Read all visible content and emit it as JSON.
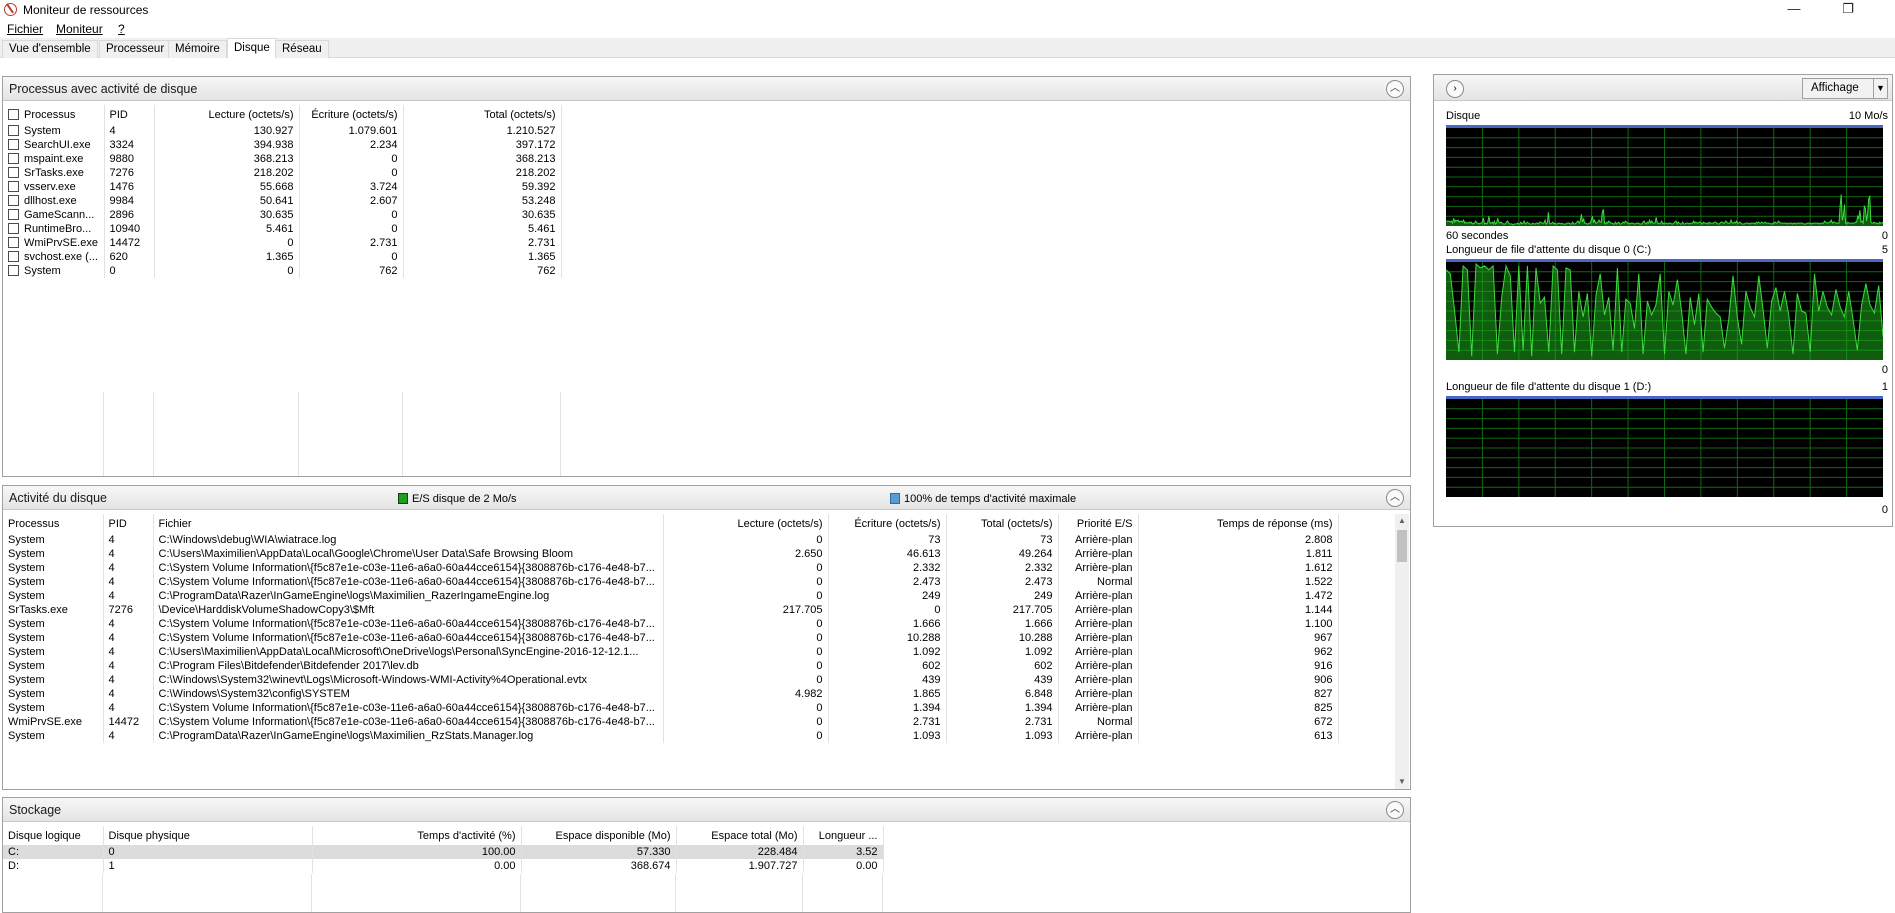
{
  "window": {
    "title": "Moniteur de ressources",
    "minimize": "—",
    "restore": "❐"
  },
  "menu": [
    {
      "label": "Fichier"
    },
    {
      "label": "Moniteur"
    },
    {
      "label": "?"
    }
  ],
  "tabs": [
    "Vue d'ensemble",
    "Processeur",
    "Mémoire",
    "Disque",
    "Réseau"
  ],
  "active_tab": "Disque",
  "processes_panel": {
    "title": "Processus avec activité de disque",
    "columns": [
      "Processus",
      "PID",
      "Lecture (octets/s)",
      "Écriture (octets/s)",
      "Total (octets/s)"
    ],
    "rows": [
      [
        "System",
        "4",
        "130.927",
        "1.079.601",
        "1.210.527"
      ],
      [
        "SearchUI.exe",
        "3324",
        "394.938",
        "2.234",
        "397.172"
      ],
      [
        "mspaint.exe",
        "9880",
        "368.213",
        "0",
        "368.213"
      ],
      [
        "SrTasks.exe",
        "7276",
        "218.202",
        "0",
        "218.202"
      ],
      [
        "vsserv.exe",
        "1476",
        "55.668",
        "3.724",
        "59.392"
      ],
      [
        "dllhost.exe",
        "9984",
        "50.641",
        "2.607",
        "53.248"
      ],
      [
        "GameScann...",
        "2896",
        "30.635",
        "0",
        "30.635"
      ],
      [
        "RuntimeBro...",
        "10940",
        "5.461",
        "0",
        "5.461"
      ],
      [
        "WmiPrvSE.exe",
        "14472",
        "0",
        "2.731",
        "2.731"
      ],
      [
        "svchost.exe (...",
        "620",
        "1.365",
        "0",
        "1.365"
      ],
      [
        "System",
        "0",
        "0",
        "762",
        "762"
      ]
    ]
  },
  "activity_panel": {
    "title": "Activité du disque",
    "legend_io": "E/S disque de 2 Mo/s",
    "legend_active": "100% de temps d'activité maximale",
    "legend_io_color": "#1e9e1e",
    "legend_active_color": "#5b9bd5",
    "columns": [
      "Processus",
      "PID",
      "Fichier",
      "Lecture (octets/s)",
      "Écriture (octets/s)",
      "Total (octets/s)",
      "Priorité E/S",
      "Temps de réponse (ms)"
    ],
    "rows": [
      [
        "System",
        "4",
        "C:\\Windows\\debug\\WIA\\wiatrace.log",
        "0",
        "73",
        "73",
        "Arrière-plan",
        "2.808"
      ],
      [
        "System",
        "4",
        "C:\\Users\\Maximilien\\AppData\\Local\\Google\\Chrome\\User Data\\Safe Browsing Bloom",
        "2.650",
        "46.613",
        "49.264",
        "Arrière-plan",
        "1.811"
      ],
      [
        "System",
        "4",
        "C:\\System Volume Information\\{f5c87e1e-c03e-11e6-a6a0-60a44cce6154}{3808876b-c176-4e48-b7...",
        "0",
        "2.332",
        "2.332",
        "Arrière-plan",
        "1.612"
      ],
      [
        "System",
        "4",
        "C:\\System Volume Information\\{f5c87e1e-c03e-11e6-a6a0-60a44cce6154}{3808876b-c176-4e48-b7...",
        "0",
        "2.473",
        "2.473",
        "Normal",
        "1.522"
      ],
      [
        "System",
        "4",
        "C:\\ProgramData\\Razer\\InGameEngine\\logs\\Maximilien_RazerIngameEngine.log",
        "0",
        "249",
        "249",
        "Arrière-plan",
        "1.472"
      ],
      [
        "SrTasks.exe",
        "7276",
        "\\Device\\HarddiskVolumeShadowCopy3\\$Mft",
        "217.705",
        "0",
        "217.705",
        "Arrière-plan",
        "1.144"
      ],
      [
        "System",
        "4",
        "C:\\System Volume Information\\{f5c87e1e-c03e-11e6-a6a0-60a44cce6154}{3808876b-c176-4e48-b7...",
        "0",
        "1.666",
        "1.666",
        "Arrière-plan",
        "1.100"
      ],
      [
        "System",
        "4",
        "C:\\System Volume Information\\{f5c87e1e-c03e-11e6-a6a0-60a44cce6154}{3808876b-c176-4e48-b7...",
        "0",
        "10.288",
        "10.288",
        "Arrière-plan",
        "967"
      ],
      [
        "System",
        "4",
        "C:\\Users\\Maximilien\\AppData\\Local\\Microsoft\\OneDrive\\logs\\Personal\\SyncEngine-2016-12-12.1...",
        "0",
        "1.092",
        "1.092",
        "Arrière-plan",
        "962"
      ],
      [
        "System",
        "4",
        "C:\\Program Files\\Bitdefender\\Bitdefender 2017\\lev.db",
        "0",
        "602",
        "602",
        "Arrière-plan",
        "916"
      ],
      [
        "System",
        "4",
        "C:\\Windows\\System32\\winevt\\Logs\\Microsoft-Windows-WMI-Activity%4Operational.evtx",
        "0",
        "439",
        "439",
        "Arrière-plan",
        "906"
      ],
      [
        "System",
        "4",
        "C:\\Windows\\System32\\config\\SYSTEM",
        "4.982",
        "1.865",
        "6.848",
        "Arrière-plan",
        "827"
      ],
      [
        "System",
        "4",
        "C:\\System Volume Information\\{f5c87e1e-c03e-11e6-a6a0-60a44cce6154}{3808876b-c176-4e48-b7...",
        "0",
        "1.394",
        "1.394",
        "Arrière-plan",
        "825"
      ],
      [
        "WmiPrvSE.exe",
        "14472",
        "C:\\System Volume Information\\{f5c87e1e-c03e-11e6-a6a0-60a44cce6154}{3808876b-c176-4e48-b7...",
        "0",
        "2.731",
        "2.731",
        "Normal",
        "672"
      ],
      [
        "System",
        "4",
        "C:\\ProgramData\\Razer\\InGameEngine\\logs\\Maximilien_RzStats.Manager.log",
        "0",
        "1.093",
        "1.093",
        "Arrière-plan",
        "613"
      ]
    ]
  },
  "storage_panel": {
    "title": "Stockage",
    "columns": [
      "Disque logique",
      "Disque physique",
      "Temps d'activité (%)",
      "Espace disponible (Mo)",
      "Espace total (Mo)",
      "Longueur ..."
    ],
    "rows": [
      [
        "C:",
        "0",
        "100.00",
        "57.330",
        "228.484",
        "3.52"
      ],
      [
        "D:",
        "1",
        "0.00",
        "368.674",
        "1.907.727",
        "0.00"
      ]
    ]
  },
  "graphs_pane": {
    "views_label": "Affichage",
    "graphs": [
      {
        "title": "Disque",
        "max_label": "10 Mo/s",
        "bottom_left": "60 secondes",
        "min_label": "0",
        "values": [
          5,
          5,
          5,
          5,
          4,
          5,
          3,
          8,
          4,
          6,
          5,
          6,
          4,
          5,
          5,
          4,
          6,
          3,
          4,
          3,
          3,
          4,
          3,
          4,
          2,
          3,
          3,
          5,
          3,
          3,
          2,
          3,
          3,
          4,
          8,
          2,
          3,
          2,
          4,
          10,
          3,
          3,
          4,
          2,
          5,
          2,
          3,
          8,
          4,
          3,
          4,
          3,
          2,
          2,
          2,
          4,
          5,
          3,
          2,
          2,
          2,
          1,
          2,
          2,
          2,
          3,
          2,
          2,
          4,
          2,
          3,
          5,
          2,
          3,
          4,
          3,
          2,
          2,
          2,
          3,
          2,
          2,
          3,
          3,
          2,
          4,
          4,
          3,
          3,
          3,
          6,
          2,
          3,
          14,
          3,
          2,
          3,
          4,
          2,
          3,
          2,
          2,
          3,
          3,
          2,
          3,
          2,
          2,
          2,
          2,
          3,
          3,
          3,
          2,
          2,
          4,
          2,
          2,
          3,
          4,
          5,
          3,
          5,
          12,
          4,
          7,
          3,
          3,
          2,
          2,
          3,
          3,
          6,
          10,
          4,
          6,
          3,
          3,
          4,
          6,
          4,
          4,
          14,
          17,
          3,
          2,
          4,
          3,
          5,
          4,
          3,
          3,
          2,
          2,
          4,
          2,
          3,
          4,
          2,
          2,
          3,
          4,
          3,
          5,
          4,
          3,
          3,
          2,
          3,
          3,
          3,
          2,
          2,
          3,
          3,
          3,
          2,
          2,
          2,
          4,
          5,
          3,
          2,
          4,
          3,
          6,
          3,
          5,
          3,
          3,
          3,
          9,
          3,
          3,
          2,
          3,
          5,
          2,
          3,
          3,
          3,
          2,
          3,
          3,
          3,
          2,
          2,
          3,
          4,
          5,
          2,
          4,
          3,
          2,
          2,
          4,
          2,
          2,
          3,
          3,
          3,
          2,
          3,
          3,
          3,
          5,
          3,
          4,
          3,
          3,
          4,
          4,
          3,
          2,
          4,
          3,
          3,
          3,
          2,
          4,
          3,
          3,
          3,
          3,
          4,
          4,
          3,
          2,
          2,
          3,
          4,
          4,
          3,
          3,
          5,
          4,
          3,
          3,
          3,
          6,
          3,
          3,
          4,
          3,
          5,
          3,
          3,
          4,
          3,
          2,
          2,
          2,
          3,
          3,
          3,
          3,
          2,
          3,
          3,
          3,
          3,
          2,
          4,
          3,
          4,
          3,
          3,
          4,
          3,
          3,
          4,
          3,
          3,
          3,
          3,
          2,
          2,
          3,
          3,
          4,
          3,
          3,
          5,
          4,
          3,
          3,
          3,
          3,
          3,
          3,
          2,
          3,
          3,
          3,
          3,
          2,
          3,
          3,
          2,
          3,
          3,
          3,
          3,
          3,
          3,
          2,
          2,
          2,
          3,
          3,
          3,
          3,
          2,
          3,
          3,
          3,
          3,
          3,
          3,
          2,
          3,
          3,
          3,
          3,
          5,
          4,
          3,
          3,
          4,
          4,
          6,
          3,
          4,
          4,
          3,
          3,
          3,
          3,
          20,
          32,
          6,
          10,
          22,
          3,
          2,
          4,
          3,
          3,
          3,
          3,
          3,
          3,
          4,
          4,
          10,
          8,
          16,
          4,
          5,
          3,
          20,
          18,
          5,
          12,
          28,
          30,
          4,
          3,
          3,
          4,
          3,
          3,
          3,
          2,
          4,
          3,
          3,
          4
        ]
      },
      {
        "title": "Longueur de file d'attente du disque 0 (C:)",
        "max_label": "5",
        "min_label": "0",
        "values": [
          4.6,
          4.4,
          2.5,
          0.4,
          4.8,
          4.6,
          0.2,
          4.9,
          4.7,
          4.8,
          4.6,
          4.8,
          0.3,
          3.2,
          4.8,
          4.3,
          0.4,
          4.8,
          0.5,
          4.8,
          0.2,
          4.7,
          2.9,
          3.2,
          0.4,
          4.8,
          4.6,
          0.3,
          4.7,
          4.6,
          0.4,
          3.5,
          2.2,
          3.4,
          0.2,
          3.3,
          4.4,
          2.3,
          3.2,
          0.5,
          4.7,
          0.4,
          3.1,
          2.9,
          1.6,
          4.4,
          0.3,
          3.0,
          2.3,
          2.8,
          4.4,
          0.3,
          3.5,
          2.8,
          4.1,
          2.5,
          0.3,
          3.2,
          1.8,
          3.4,
          0.4,
          3.1,
          2.7,
          2.4,
          2.2,
          0.6,
          2.1,
          4.3,
          2.2,
          0.8,
          3.5,
          2.7,
          2.2,
          4.3,
          2.6,
          0.6,
          3.0,
          3.7,
          2.5,
          3.5,
          2.3,
          0.3,
          3.4,
          2.5,
          2.4,
          0.4,
          4.4,
          2.5,
          3.5,
          2.7,
          2.3,
          3.6,
          2.7,
          2.2,
          3.5,
          2.1,
          0.5,
          2.8,
          3.9,
          2.8,
          2.4,
          3.8,
          1.2
        ]
      },
      {
        "title": "Longueur de file d'attente du disque 1 (D:)",
        "max_label": "1",
        "min_label": "0",
        "values": []
      }
    ]
  }
}
